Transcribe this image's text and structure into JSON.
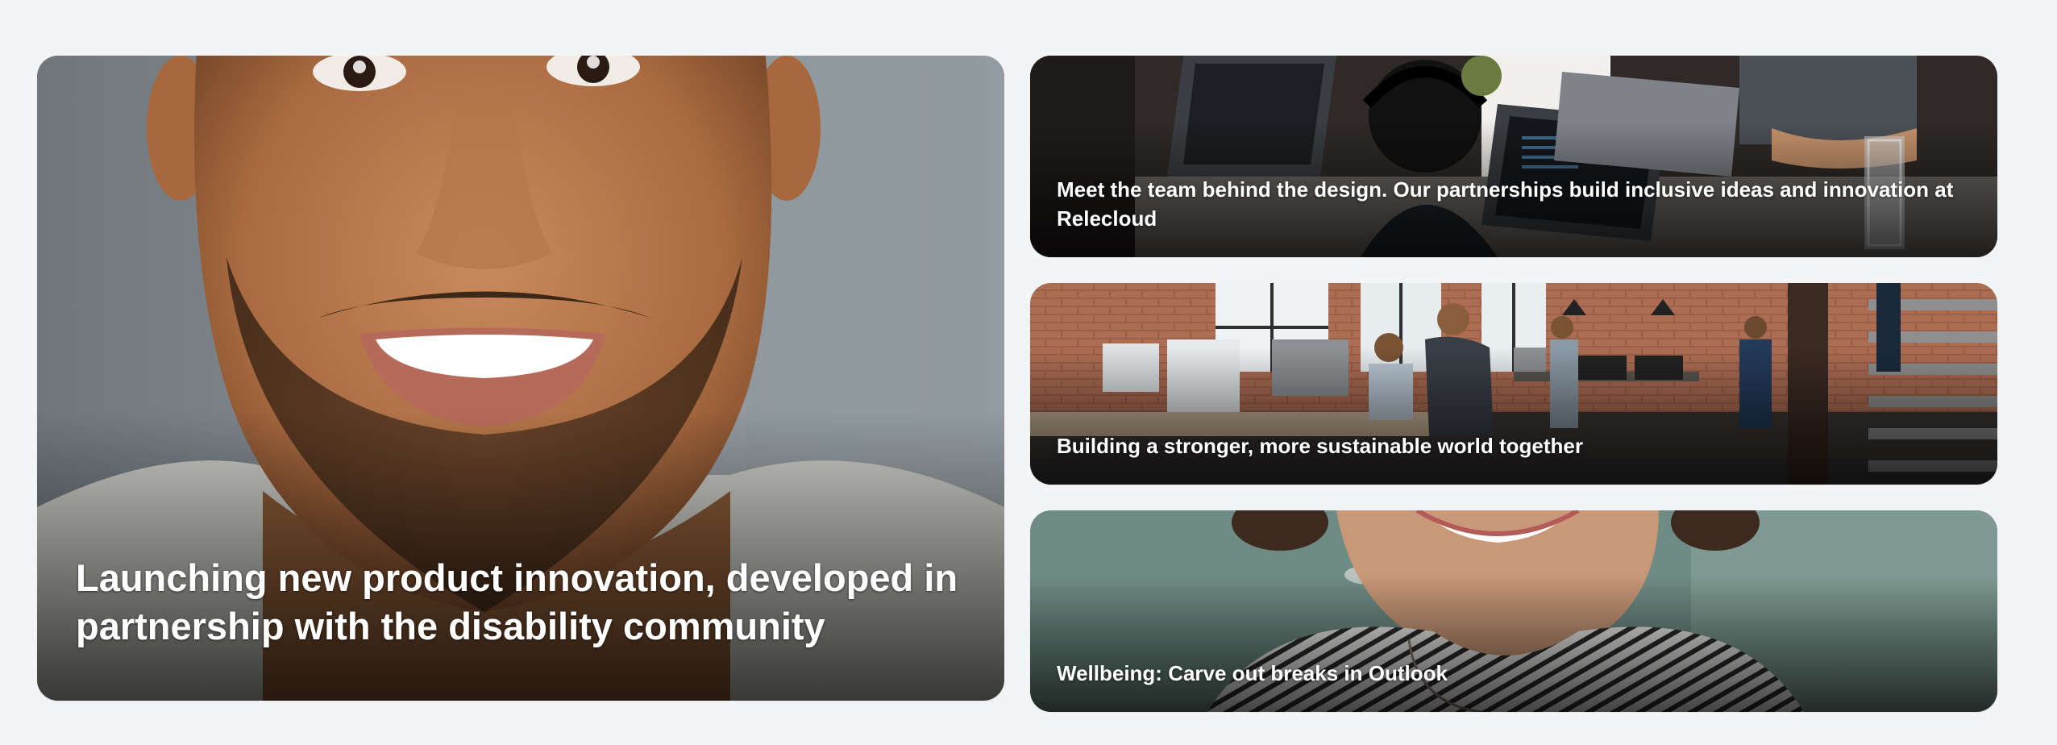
{
  "featured": {
    "main": {
      "title": "Launching new product innovation, developed in partnership with the disability community",
      "image": "portrait-smiling-man"
    },
    "side": [
      {
        "title": "Meet the team behind the design. Our partnerships build inclusive ideas and innovation at Relecloud",
        "image": "team-at-laptops"
      },
      {
        "title": "Building a stronger, more sustainable world together",
        "image": "open-plan-office"
      },
      {
        "title": "Wellbeing: Carve out breaks in Outlook",
        "image": "smiling-woman-portrait"
      }
    ]
  }
}
